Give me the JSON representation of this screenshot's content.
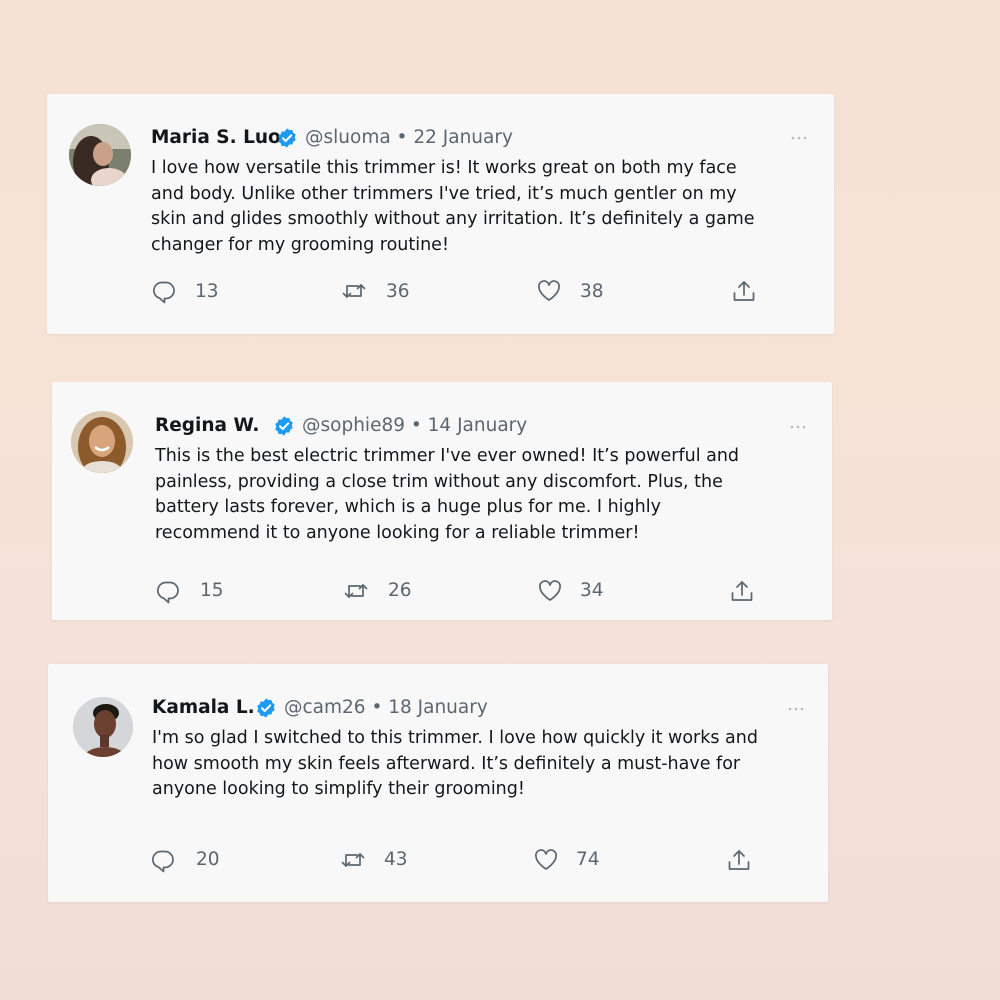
{
  "colors": {
    "background_top": "#f5e2d4",
    "card": "#f8f8f9",
    "verified": "#1d9bf0",
    "text": "#14171a",
    "muted": "#5b6670"
  },
  "icons": {
    "reply": "reply-icon",
    "retweet": "retweet-icon",
    "like": "heart-icon",
    "share": "share-icon",
    "verified": "verified-badge-icon"
  },
  "tweets": [
    {
      "name": "Maria S. Luo",
      "meta": "@sluoma • 22 January",
      "text_lines": [
        "I love how versatile this trimmer is! It works great on both my face",
        "and body. Unlike other trimmers I've tried, it’s much gentler on my",
        "skin and glides smoothly without any irritation. It’s definitely a game",
        "changer for my grooming routine!"
      ],
      "replies": "13",
      "retweets": "36",
      "likes": "38"
    },
    {
      "name": "Regina W.",
      "meta": "@sophie89 • 14 January",
      "text_lines": [
        "This is the best electric trimmer I've ever owned! It’s powerful and",
        "painless, providing a close trim without any discomfort. Plus, the",
        "battery lasts forever, which is a huge plus for me. I highly",
        "recommend it to anyone looking for a reliable trimmer!"
      ],
      "replies": "15",
      "retweets": "26",
      "likes": "34"
    },
    {
      "name": "Kamala L.",
      "meta": "@cam26 • 18 January",
      "text_lines": [
        "I'm so glad I switched to this trimmer. I love how quickly it works and",
        "how smooth my skin feels afterward. It’s definitely a must-have for",
        "anyone looking to simplify their grooming!"
      ],
      "replies": "20",
      "retweets": "43",
      "likes": "74"
    }
  ]
}
